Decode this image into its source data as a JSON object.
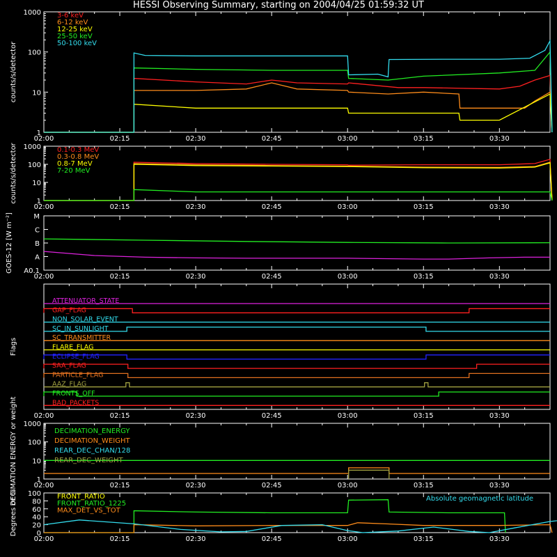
{
  "title": "HESSI Observing Summary, starting on 2004/04/25 01:59:32 UT",
  "colors": {
    "bg": "#000000",
    "axes": "#ffffff",
    "red": "#ff2020",
    "orange": "#ff8c1a",
    "yellow": "#ffff00",
    "green": "#22ee22",
    "cyan": "#33ddee",
    "magenta": "#dd22dd",
    "blue": "#2222ff",
    "olive": "#a0a040",
    "darkorange": "#e07020"
  },
  "time_ticks": [
    "02:00",
    "02:15",
    "02:30",
    "02:45",
    "03:00",
    "03:15",
    "03:30"
  ],
  "chart_data": [
    {
      "type": "line",
      "ylabel": "counts/s/detector",
      "yscale": "log",
      "ylim": [
        1,
        1000
      ],
      "ytick_labels": [
        "1",
        "10",
        "100",
        "1000"
      ],
      "xlim_minutes": [
        0,
        100
      ],
      "legend_placement": "top-left",
      "series": [
        {
          "name": "3-6 keV",
          "color": "#ff2020",
          "points": [
            [
              0,
              1
            ],
            [
              17.8,
              1
            ],
            [
              17.8,
              22
            ],
            [
              30,
              18
            ],
            [
              40,
              16
            ],
            [
              45,
              20
            ],
            [
              50,
              17
            ],
            [
              60,
              16
            ],
            [
              60.2,
              17
            ],
            [
              70,
              13
            ],
            [
              75,
              13
            ],
            [
              75.2,
              13
            ],
            [
              90,
              12
            ],
            [
              94,
              14
            ],
            [
              97,
              20
            ],
            [
              100,
              26
            ],
            [
              100.4,
              1
            ]
          ]
        },
        {
          "name": "6-12 keV",
          "color": "#ff8c1a",
          "points": [
            [
              0,
              1
            ],
            [
              17.8,
              1
            ],
            [
              17.8,
              11
            ],
            [
              30,
              11
            ],
            [
              40,
              12
            ],
            [
              45,
              17
            ],
            [
              50,
              12
            ],
            [
              60,
              11
            ],
            [
              60.2,
              10
            ],
            [
              68,
              9
            ],
            [
              75,
              10
            ],
            [
              82,
              9
            ],
            [
              82.2,
              4
            ],
            [
              90,
              4
            ],
            [
              95,
              4
            ],
            [
              97,
              6
            ],
            [
              100,
              10
            ],
            [
              100.4,
              1
            ]
          ]
        },
        {
          "name": "12-25 keV",
          "color": "#ffff00",
          "points": [
            [
              0,
              1
            ],
            [
              17.8,
              1
            ],
            [
              17.8,
              5
            ],
            [
              30,
              4
            ],
            [
              45,
              4
            ],
            [
              60,
              4
            ],
            [
              60.2,
              3
            ],
            [
              75,
              3
            ],
            [
              82,
              3
            ],
            [
              82.2,
              2
            ],
            [
              90,
              2
            ],
            [
              100,
              9
            ],
            [
              100.4,
              1
            ]
          ]
        },
        {
          "name": "25-50 keV",
          "color": "#22ee22",
          "points": [
            [
              0,
              1
            ],
            [
              17.8,
              1
            ],
            [
              17.8,
              40
            ],
            [
              30,
              37
            ],
            [
              45,
              35
            ],
            [
              60,
              35
            ],
            [
              60.2,
              22
            ],
            [
              68,
              20
            ],
            [
              75,
              25
            ],
            [
              90,
              30
            ],
            [
              97,
              35
            ],
            [
              100,
              100
            ],
            [
              100.4,
              1
            ]
          ]
        },
        {
          "name": "50-100 keV",
          "color": "#33ddee",
          "points": [
            [
              0,
              1
            ],
            [
              17.8,
              1
            ],
            [
              17.8,
              95
            ],
            [
              20,
              82
            ],
            [
              30,
              80
            ],
            [
              45,
              80
            ],
            [
              60,
              80
            ],
            [
              60.2,
              27
            ],
            [
              66,
              28
            ],
            [
              68,
              24
            ],
            [
              68.2,
              65
            ],
            [
              80,
              66
            ],
            [
              90,
              66
            ],
            [
              96,
              70
            ],
            [
              99,
              110
            ],
            [
              100,
              190
            ],
            [
              100.4,
              1
            ]
          ]
        }
      ]
    },
    {
      "type": "line",
      "ylabel": "counts/s/detector",
      "yscale": "log",
      "ylim": [
        1,
        1000
      ],
      "ytick_labels": [
        "1",
        "10",
        "100",
        "1000"
      ],
      "xlim_minutes": [
        0,
        100
      ],
      "legend_placement": "top-left",
      "series": [
        {
          "name": "0.1-0.3 MeV",
          "color": "#ff2020",
          "points": [
            [
              0,
              1
            ],
            [
              17.8,
              1
            ],
            [
              17.8,
              130
            ],
            [
              30,
              110
            ],
            [
              45,
              100
            ],
            [
              60,
              95
            ],
            [
              60.2,
              90
            ],
            [
              75,
              95
            ],
            [
              90,
              95
            ],
            [
              97,
              110
            ],
            [
              100,
              190
            ],
            [
              100.4,
              1
            ]
          ]
        },
        {
          "name": "0.3-0.8 MeV",
          "color": "#ff8c1a",
          "points": [
            [
              0,
              1
            ],
            [
              17.8,
              1
            ],
            [
              17.8,
              110
            ],
            [
              30,
              95
            ],
            [
              45,
              85
            ],
            [
              60,
              80
            ],
            [
              75,
              70
            ],
            [
              90,
              68
            ],
            [
              97,
              75
            ],
            [
              100,
              130
            ],
            [
              100.4,
              1
            ]
          ]
        },
        {
          "name": "0.8-7 MeV",
          "color": "#ffff00",
          "points": [
            [
              0,
              1
            ],
            [
              17.8,
              1
            ],
            [
              17.8,
              100
            ],
            [
              30,
              85
            ],
            [
              45,
              80
            ],
            [
              60,
              75
            ],
            [
              75,
              65
            ],
            [
              90,
              62
            ],
            [
              97,
              70
            ],
            [
              100,
              120
            ],
            [
              100.4,
              1
            ]
          ]
        },
        {
          "name": "7-20 MeV",
          "color": "#22ee22",
          "points": [
            [
              0,
              1
            ],
            [
              17.8,
              1
            ],
            [
              17.8,
              4
            ],
            [
              30,
              3
            ],
            [
              45,
              3
            ],
            [
              60,
              3
            ],
            [
              75,
              3
            ],
            [
              90,
              3
            ],
            [
              100,
              3
            ],
            [
              100.4,
              1
            ]
          ]
        }
      ]
    },
    {
      "type": "line",
      "ylabel": "GOES-12 [W m⁻²]",
      "yscale": "log",
      "ytick_labels": [
        "A0.1",
        "A",
        "B",
        "C",
        "M"
      ],
      "xlim_minutes": [
        0,
        100
      ],
      "series": [
        {
          "color": "#22ee22",
          "points": [
            [
              0,
              2e-06
            ],
            [
              20,
              1.6e-06
            ],
            [
              40,
              1.3e-06
            ],
            [
              60,
              1.1e-06
            ],
            [
              80,
              1e-06
            ],
            [
              100,
              1.05e-06
            ]
          ]
        },
        {
          "color": "#dd22dd",
          "points": [
            [
              0,
              2.4e-07
            ],
            [
              10,
              1.2e-07
            ],
            [
              20,
              9e-08
            ],
            [
              30,
              8e-08
            ],
            [
              40,
              7.5e-08
            ],
            [
              60,
              7.5e-08
            ],
            [
              75,
              6.5e-08
            ],
            [
              80,
              6.5e-08
            ],
            [
              88,
              8e-08
            ],
            [
              95,
              9e-08
            ],
            [
              100,
              9e-08
            ]
          ]
        }
      ]
    },
    {
      "type": "line",
      "ylabel": "Flags",
      "xlim_minutes": [
        0,
        100
      ],
      "flags": [
        {
          "name": "ATTENUATOR_STATE",
          "color": "#dd22dd",
          "on": []
        },
        {
          "name": "GAP_FLAG",
          "color": "#ff2020",
          "on": [
            [
              0,
              17.5
            ],
            [
              84,
              100
            ]
          ]
        },
        {
          "name": "NON_SOLAR_EVENT",
          "color": "#33ddee",
          "on": []
        },
        {
          "name": "SC_IN_SUNLIGHT",
          "color": "#33ddee",
          "on": [
            [
              16.4,
              75.5
            ]
          ]
        },
        {
          "name": "SC_TRANSMITTER",
          "color": "#ff8c1a",
          "on": []
        },
        {
          "name": "FLARE_FLAG",
          "color": "#ffff00",
          "on": []
        },
        {
          "name": "ECLIPSE_FLAG",
          "color": "#2222ff",
          "on": [
            [
              0,
              16.4
            ],
            [
              75.5,
              100
            ]
          ]
        },
        {
          "name": "SAA_FLAG",
          "color": "#ff2020",
          "on": [
            [
              0,
              16.6
            ],
            [
              85.5,
              100
            ]
          ]
        },
        {
          "name": "PARTICLE_FLAG",
          "color": "#e07020",
          "on": [
            [
              0,
              16.6
            ],
            [
              84,
              100
            ]
          ]
        },
        {
          "name": "AAZ_FLAG",
          "color": "#a0a040",
          "on": [
            [
              16.2,
              16.9
            ],
            [
              75.2,
              75.9
            ]
          ]
        },
        {
          "name": "FRONTS_OFF",
          "color": "#22ee22",
          "on": [
            [
              0,
              6.5
            ],
            [
              78,
              100
            ]
          ]
        },
        {
          "name": "BAD_PACKETS",
          "color": "#ff2020",
          "on": []
        }
      ]
    },
    {
      "type": "line",
      "ylabel": "DECIMATION ENERGY or weight",
      "yscale": "log",
      "ylim": [
        1,
        1000
      ],
      "ytick_labels": [
        "1",
        "10",
        "100",
        "1000"
      ],
      "xlim_minutes": [
        0,
        100
      ],
      "legend_placement": "top-left",
      "series": [
        {
          "name": "DECIMATION_ENERGY",
          "color": "#22ee22",
          "points": [
            [
              0,
              10
            ],
            [
              100,
              10
            ]
          ]
        },
        {
          "name": "DECIMATION_WEIGHT",
          "color": "#ff8c1a",
          "points": [
            [
              0,
              2
            ],
            [
              60.2,
              2
            ],
            [
              60.2,
              4
            ],
            [
              68.2,
              4
            ],
            [
              68.2,
              2
            ],
            [
              100,
              2
            ]
          ]
        },
        {
          "name": "REAR_DEC_CHAN/128",
          "color": "#33ddee",
          "points": []
        },
        {
          "name": "REAR_DEC_WEIGHT",
          "color": "#a0a040",
          "points": [
            [
              60.2,
              1
            ],
            [
              60.2,
              3
            ],
            [
              68.2,
              3
            ],
            [
              68.2,
              1
            ]
          ]
        }
      ]
    },
    {
      "type": "line",
      "ylabel": "Degrees or %",
      "ylim": [
        0,
        100
      ],
      "ytick_labels": [
        "0",
        "20",
        "40",
        "60",
        "80",
        "100"
      ],
      "xlim_minutes": [
        0,
        100
      ],
      "legend_placement": "top-left",
      "annotation": "Absolute geomagnetic latitude",
      "series": [
        {
          "name": "FRONT_RATIO",
          "color": "#ffff00",
          "points": []
        },
        {
          "name": "FRONT_RATIO_1225",
          "color": "#22ee22",
          "points": [
            [
              0,
              0
            ],
            [
              17.8,
              0
            ],
            [
              17.8,
              55
            ],
            [
              30,
              52
            ],
            [
              45,
              50
            ],
            [
              60,
              50
            ],
            [
              60.2,
              82
            ],
            [
              68,
              83
            ],
            [
              68.2,
              52
            ],
            [
              80,
              50
            ],
            [
              91,
              50
            ],
            [
              91.2,
              0
            ]
          ]
        },
        {
          "name": "MAX_DET_VS_TOT",
          "color": "#ff8c1a",
          "points": [
            [
              0,
              0
            ],
            [
              17.8,
              0
            ],
            [
              17.8,
              20
            ],
            [
              30,
              17
            ],
            [
              45,
              18
            ],
            [
              60,
              18
            ],
            [
              62,
              25
            ],
            [
              68,
              22
            ],
            [
              75,
              18
            ],
            [
              90,
              18
            ],
            [
              100,
              20
            ],
            [
              100.4,
              0
            ]
          ]
        },
        {
          "name": "Absolute geomagnetic latitude",
          "color": "#33ddee",
          "points": [
            [
              0,
              20
            ],
            [
              7,
              32
            ],
            [
              18,
              22
            ],
            [
              27,
              8
            ],
            [
              35,
              2
            ],
            [
              40,
              3
            ],
            [
              47,
              18
            ],
            [
              55,
              20
            ],
            [
              60,
              5
            ],
            [
              63,
              0
            ],
            [
              70,
              4
            ],
            [
              77,
              14
            ],
            [
              84,
              3
            ],
            [
              88,
              0
            ],
            [
              93,
              12
            ],
            [
              100,
              28
            ],
            [
              105,
              35
            ]
          ]
        }
      ]
    }
  ]
}
